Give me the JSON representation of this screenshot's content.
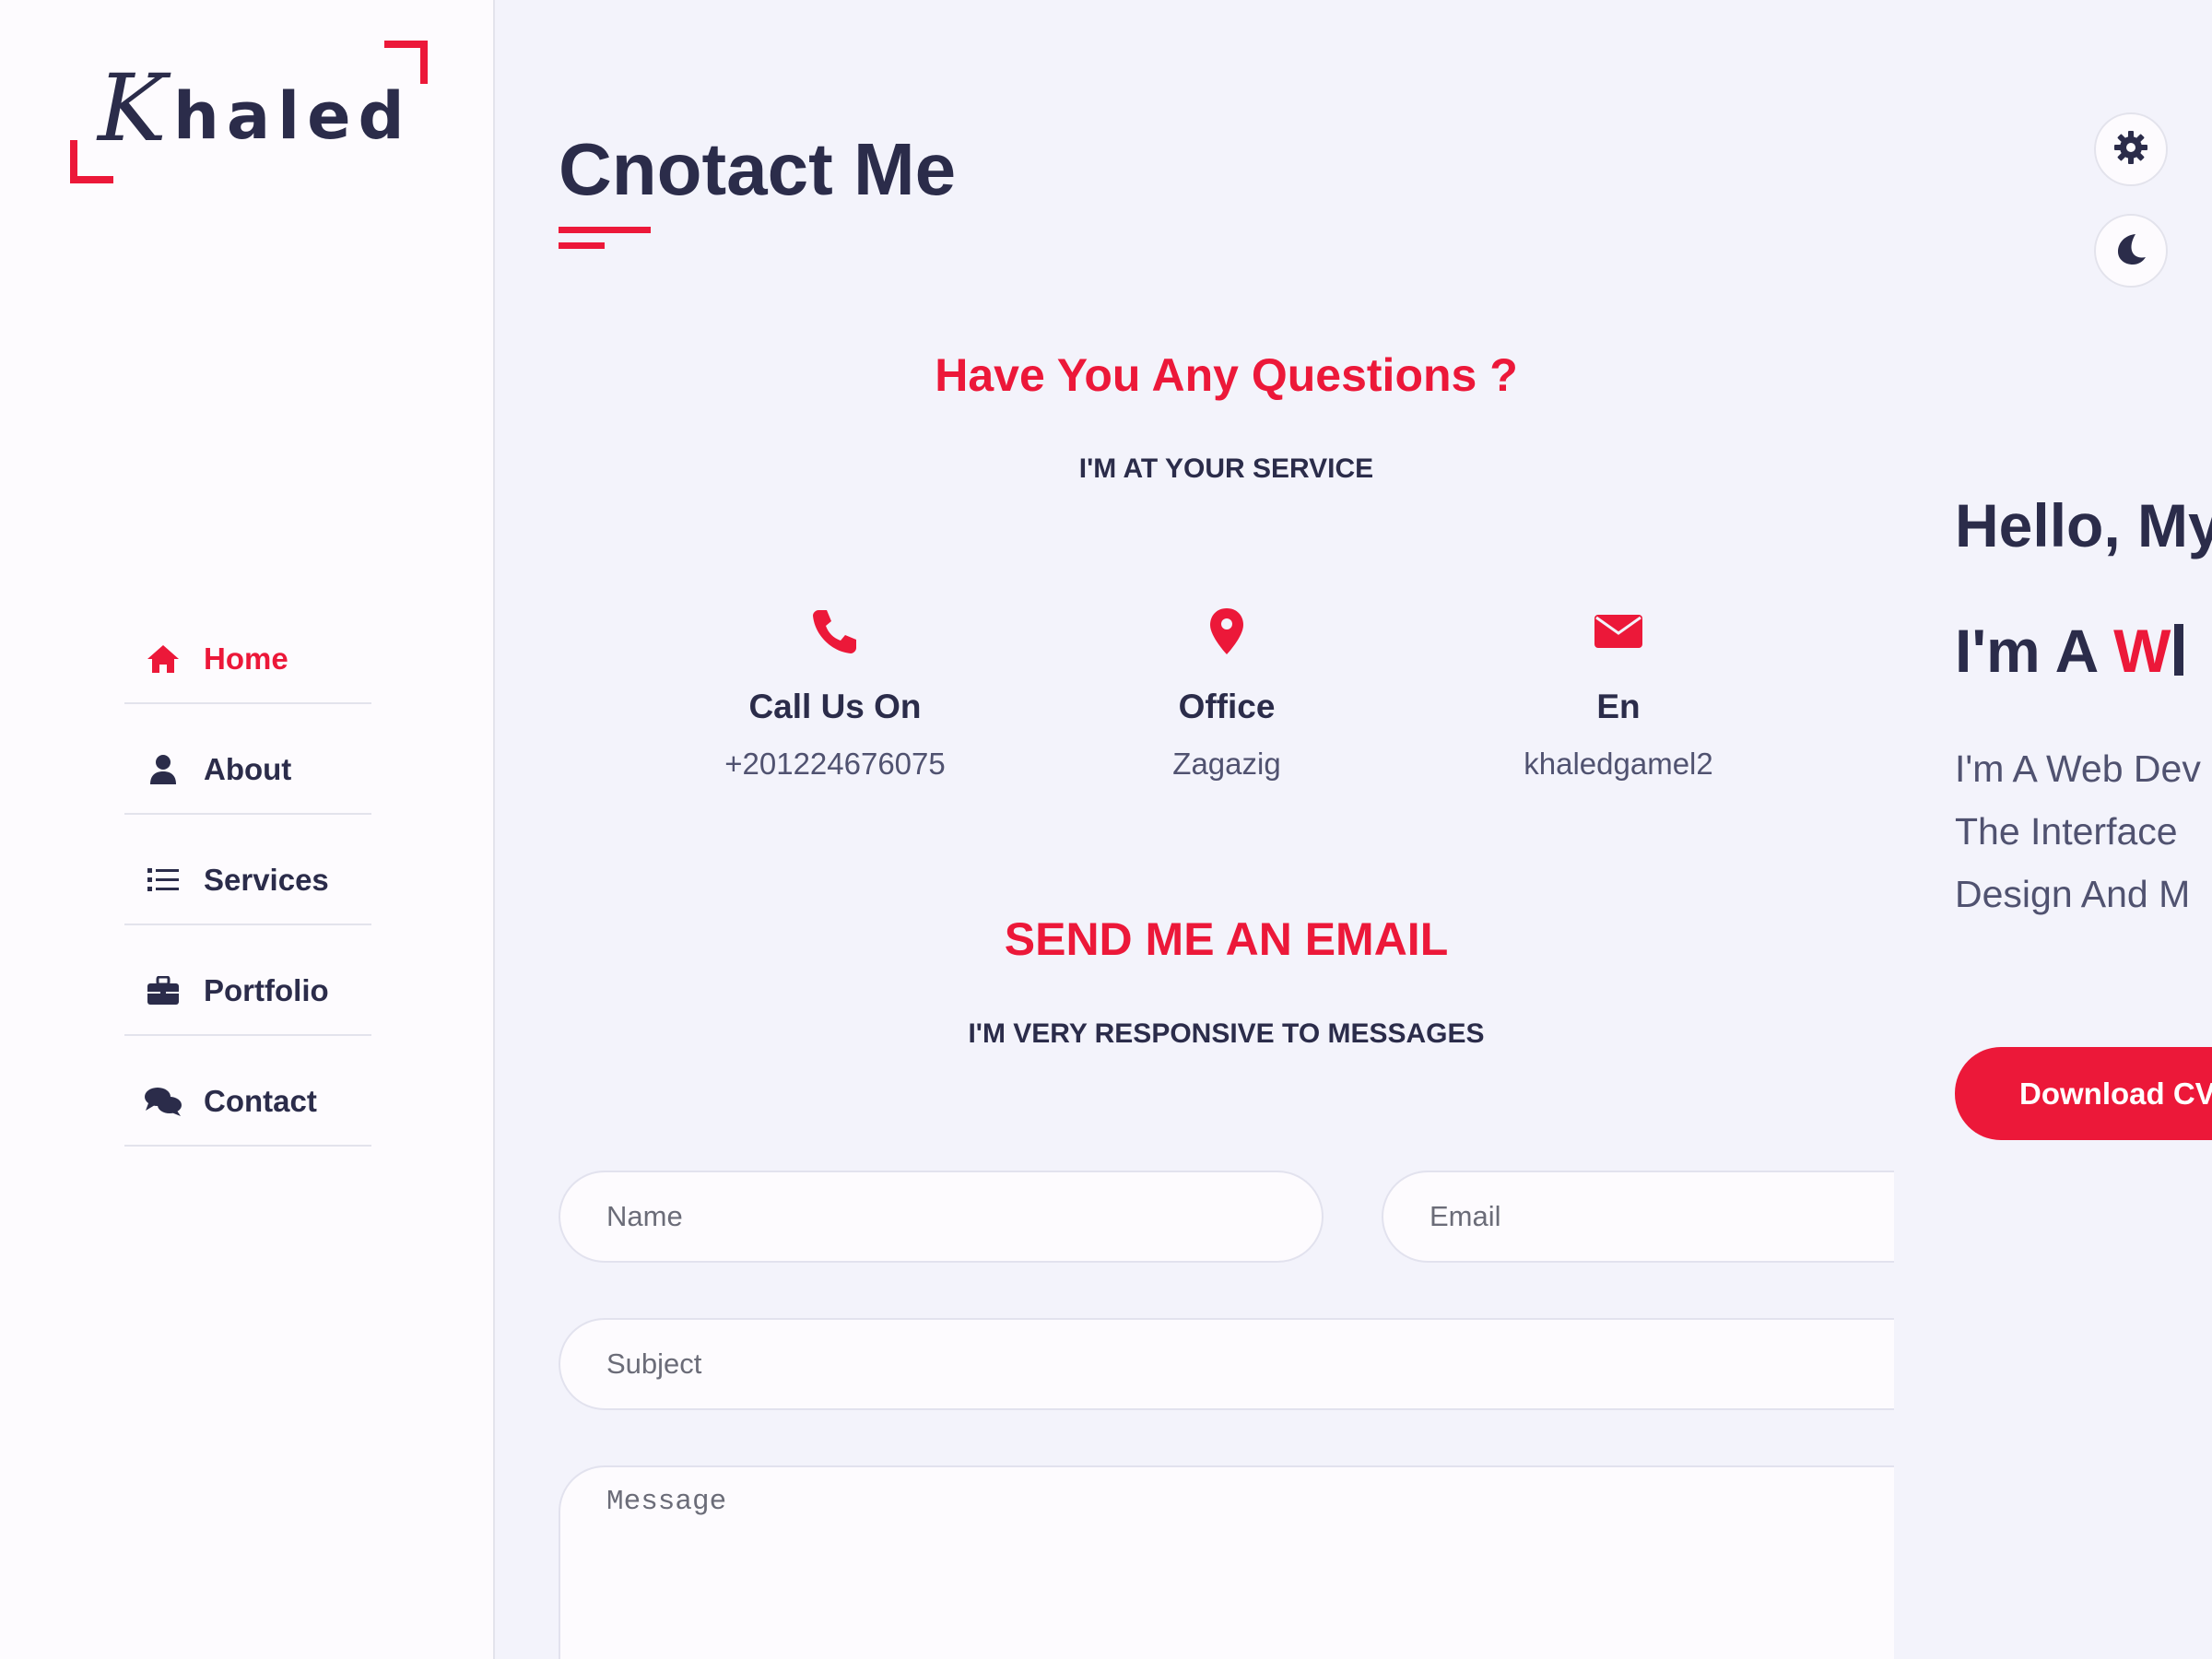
{
  "logo": {
    "first_letter": "K",
    "rest": "haled"
  },
  "nav": {
    "items": [
      {
        "label": "Home",
        "icon": "home-icon",
        "active": true
      },
      {
        "label": "About",
        "icon": "user-icon",
        "active": false
      },
      {
        "label": "Services",
        "icon": "list-icon",
        "active": false
      },
      {
        "label": "Portfolio",
        "icon": "briefcase-icon",
        "active": false
      },
      {
        "label": "Contact",
        "icon": "comments-icon",
        "active": false
      }
    ]
  },
  "contact": {
    "title": "Cnotact Me",
    "questions_title": "Have You Any Questions ?",
    "questions_subtitle": "I'M AT YOUR SERVICE",
    "info": [
      {
        "icon": "phone-icon",
        "title": "Call Us On",
        "value": "+201224676075"
      },
      {
        "icon": "map-marker-icon",
        "title": "Office",
        "value": "Zagazig"
      },
      {
        "icon": "envelope-icon",
        "title": "En",
        "value": "khaledgamel2"
      }
    ],
    "email_title": "SEND ME AN EMAIL",
    "email_subtitle": "I'M VERY RESPONSIVE TO MESSAGES",
    "form": {
      "name_placeholder": "Name",
      "email_placeholder": "Email",
      "subject_placeholder": "Subject",
      "message_placeholder": "Message"
    }
  },
  "home_peek": {
    "hello": "Hello, My",
    "ima_prefix": "I'm A ",
    "ima_typed": "W",
    "desc_lines": [
      "I'm A Web Dev",
      "The Interface",
      "Design And M"
    ],
    "download_button": "Download CV"
  },
  "switcher": {
    "settings_icon": "gear-icon",
    "theme_icon": "moon-icon"
  },
  "colors": {
    "accent": "#ec1839",
    "text_dark": "#2b2c4a",
    "background": "#f3f3fb",
    "sidebar": "#fdfbfe"
  }
}
